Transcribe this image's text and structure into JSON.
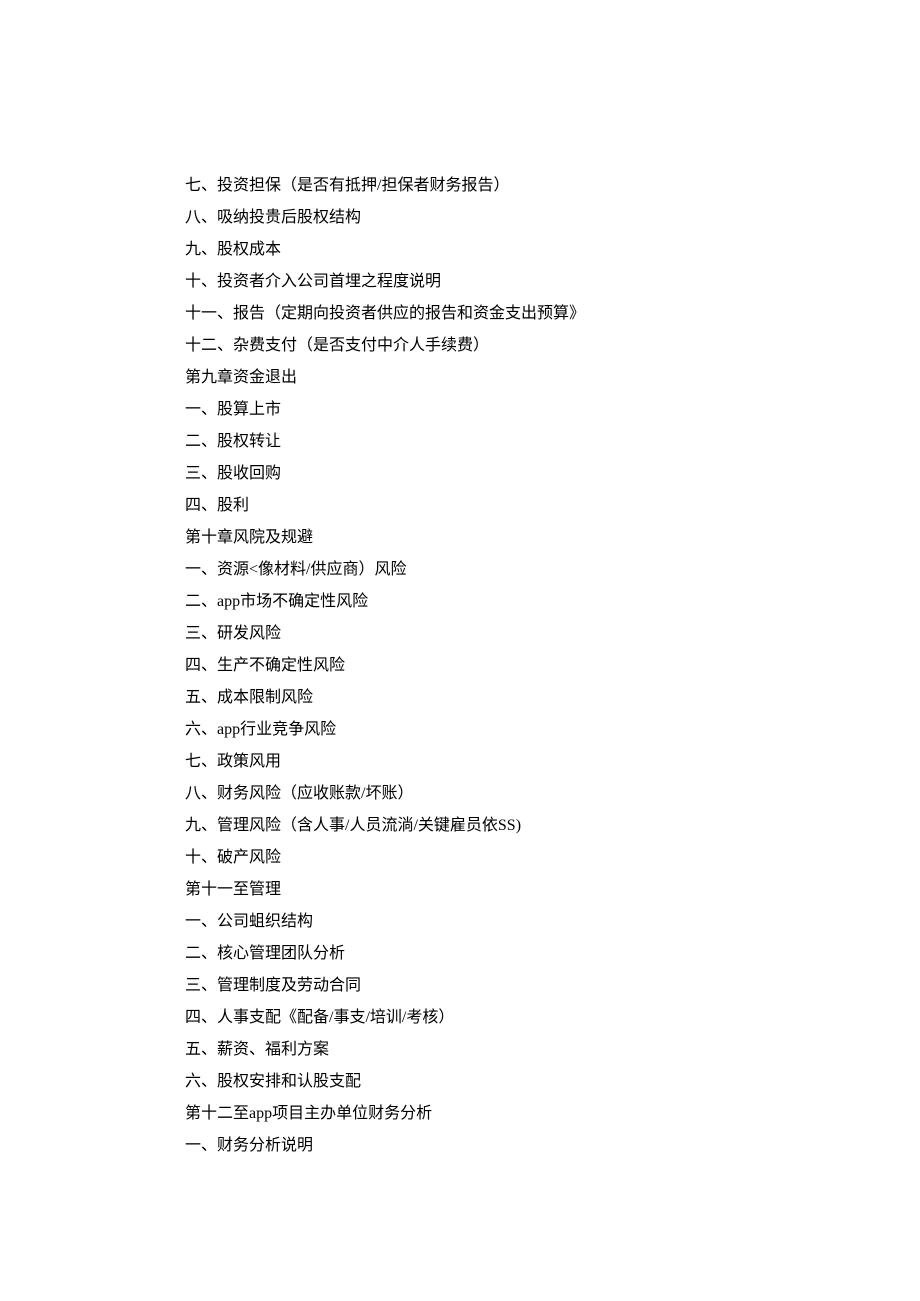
{
  "lines": [
    "七、投资担保（是否有抵押/担保者财务报告）",
    "八、吸纳投贵后股权结构",
    "九、股权成本",
    "十、投资者介入公司首埋之程度说明",
    "十一、报告（定期向投资者供应的报告和资金支出预算》",
    "十二、杂费支付（是否支付中介人手续费）",
    "第九章资金退出",
    "一、股算上市",
    "二、股权转让",
    "三、股收回购",
    "四、股利",
    "第十章风院及规避",
    "一、资源<像材料/供应商）风险",
    "二、app市场不确定性风险",
    "三、研发风险",
    "四、生产不确定性风险",
    "五、成本限制风险",
    "六、app行业竞争风险",
    "七、政策风用",
    "八、财务风险（应收账款/坏账）",
    "九、管理风险（含人事/人员流淌/关键雇员依SS)",
    "十、破产风险",
    "第十一至管理",
    "一、公司蛆织结构",
    "二、核心管理团队分析",
    "三、管理制度及劳动合同",
    "四、人事支配《配备/事支/培训/考核）",
    "五、薪资、福利方案",
    "六、股权安排和认股支配",
    "第十二至app项目主办单位财务分析",
    "一、财务分析说明"
  ]
}
